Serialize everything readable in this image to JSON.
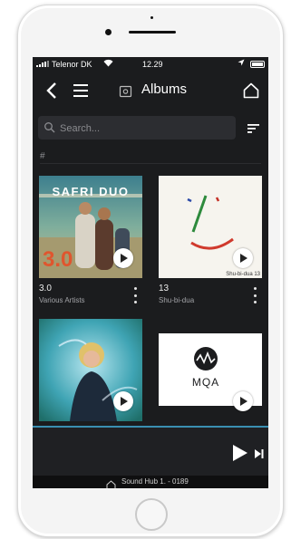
{
  "status_bar": {
    "carrier": "Telenor DK",
    "time": "12.29"
  },
  "nav": {
    "title": "Albums",
    "icons": [
      "back-icon",
      "menu-icon",
      "album-icon",
      "home-icon"
    ]
  },
  "search": {
    "placeholder": "Search...",
    "value": ""
  },
  "section": {
    "header": "#"
  },
  "albums": [
    {
      "cover_text": "SAFRI DUO",
      "cover_number": "3.0",
      "title": "3.0",
      "artist": "Various Artists"
    },
    {
      "cover_text": "Shu-bi-dua 13",
      "title": "13",
      "artist": "Shu-bi-dua"
    },
    {
      "title": "",
      "artist": ""
    },
    {
      "cover_text": "MQA",
      "title": "",
      "artist": ""
    }
  ],
  "player": {
    "icons": [
      "play-icon",
      "next-track-icon"
    ]
  },
  "footer": {
    "device": "Sound Hub 1. - 0189"
  },
  "colors": {
    "screen_bg": "#1b1c1e",
    "accent": "#3a8fb1"
  }
}
